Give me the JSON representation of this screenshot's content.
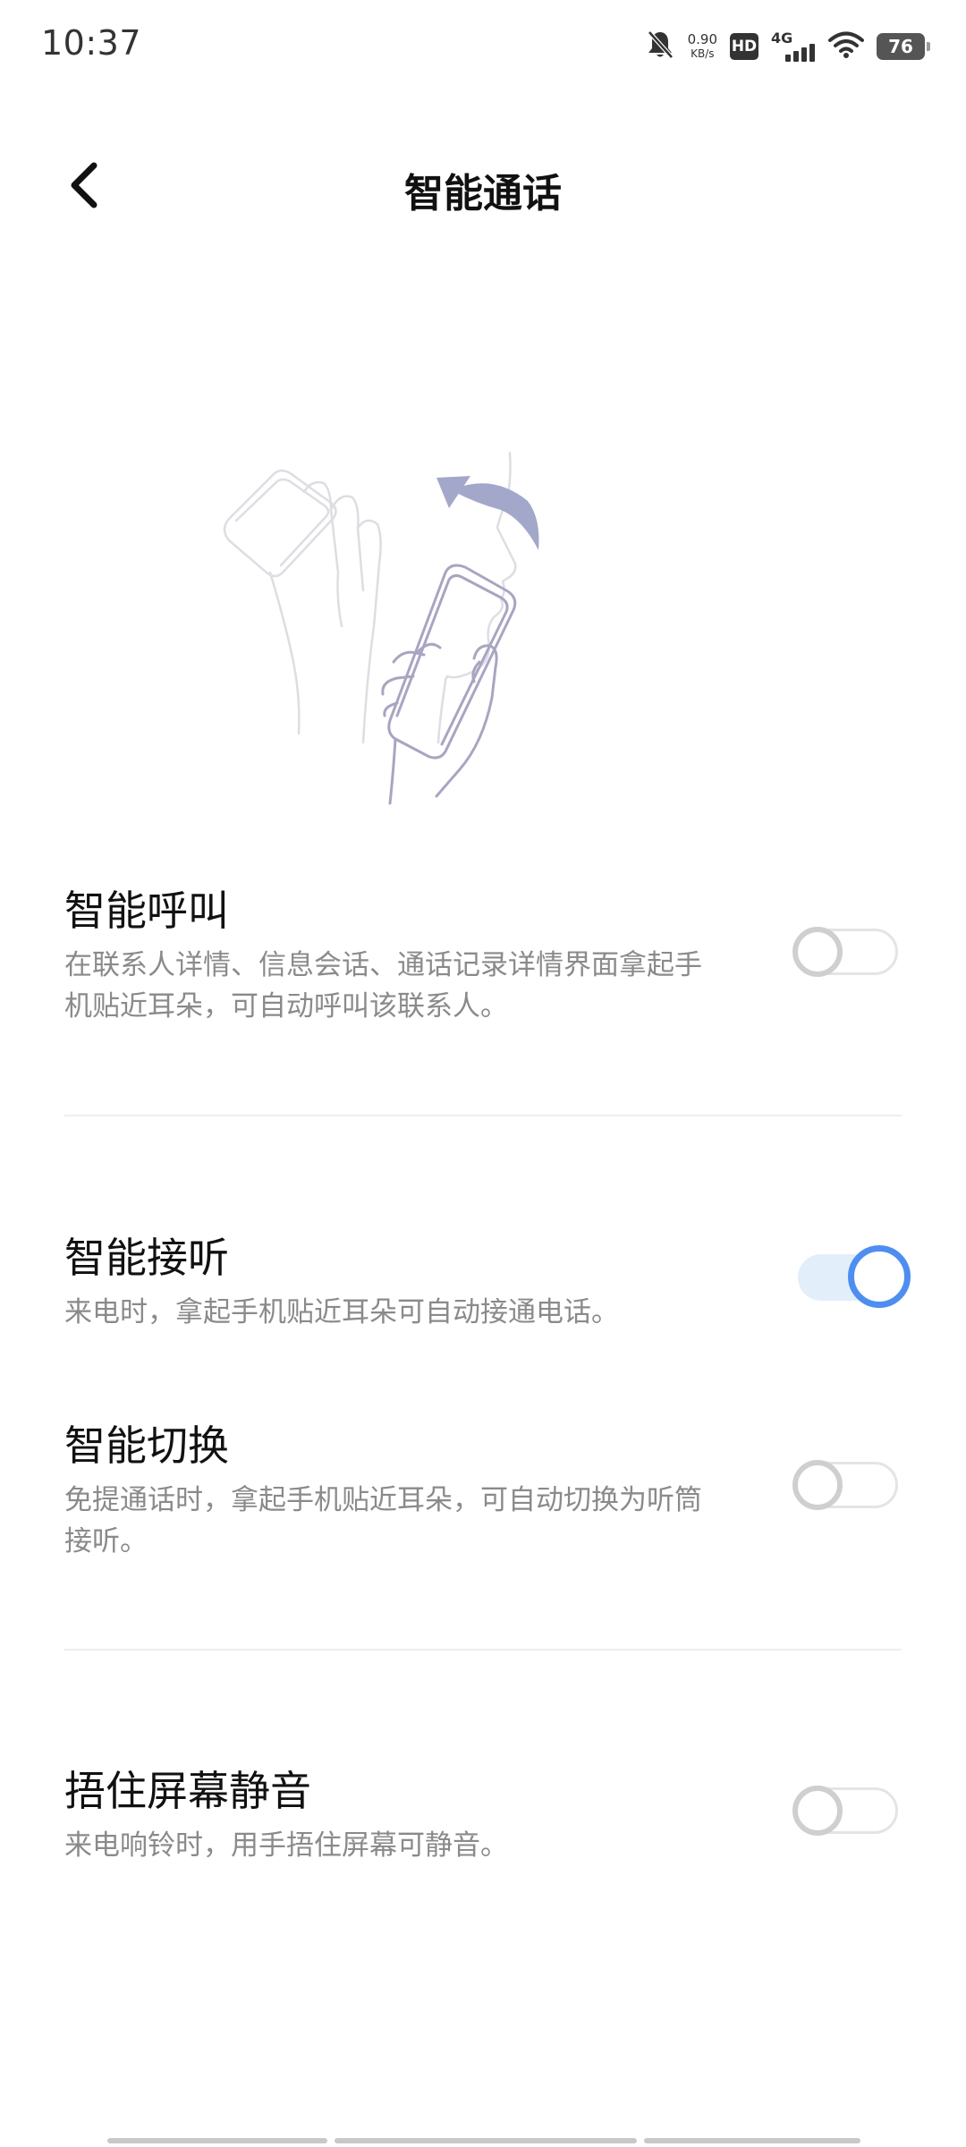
{
  "status_bar": {
    "time": "10:37",
    "speed_value": "0.90",
    "speed_unit": "KB/s",
    "hd_label": "HD",
    "network_label": "4G",
    "battery_level": "76",
    "icons": [
      "bell-muted-icon",
      "wifi-icon",
      "signal-icon",
      "battery-icon"
    ]
  },
  "header": {
    "title": "智能通话",
    "back_icon": "chevron-left-icon"
  },
  "illustration": {
    "icon": "raise-to-ear-illustration",
    "arrow_color": "#a3a7c9",
    "line_color": "#a8a5c2"
  },
  "settings": [
    {
      "title": "智能呼叫",
      "description": "在联系人详情、信息会话、通话记录详情界面拿起手机贴近耳朵，可自动呼叫该联系人。",
      "enabled": false
    },
    {
      "title": "智能接听",
      "description": "来电时，拿起手机贴近耳朵可自动接通电话。",
      "enabled": true
    },
    {
      "title": "智能切换",
      "description": "免提通话时，拿起手机贴近耳朵，可自动切换为听筒接听。",
      "enabled": false
    },
    {
      "title": "捂住屏幕静音",
      "description": "来电响铃时，用手捂住屏幕可静音。",
      "enabled": false
    }
  ],
  "colors": {
    "accent": "#4e8ef0",
    "accent_track": "#e3eefb",
    "toggle_off": "#cfcfcf",
    "description_text": "#8a8a8a"
  }
}
